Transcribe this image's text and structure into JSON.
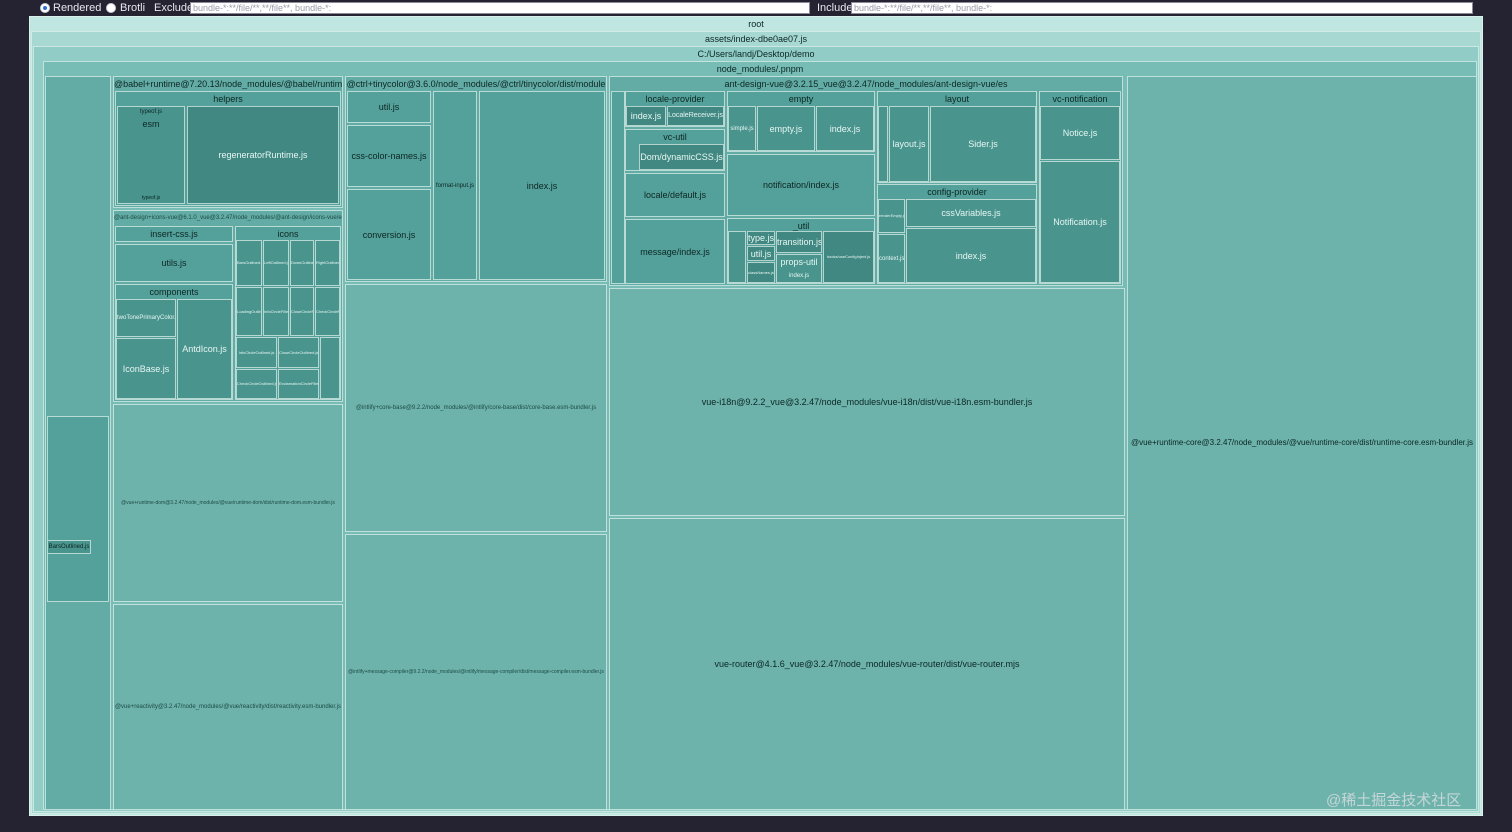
{
  "controls": {
    "rendered_label": "Rendered",
    "brotli_label": "Brotli",
    "exclude_label": "Exclude",
    "exclude_value": "bundle-*:**/file/**,**/file**, bundle-*:",
    "include_label": "Include",
    "include_value": "bundle-*:**/file/**,**/file**, bundle-*:"
  },
  "tree": {
    "root": "root",
    "asset": "assets/index-dbe0ae07.js",
    "path": "C:/Users/landj/Desktop/demo",
    "node_modules": "node_modules/.pnpm"
  },
  "babel": {
    "title": "@babel+runtime@7.20.13/node_modules/@babel/runtime",
    "helpers": "helpers",
    "typeof": "typeof.js",
    "esm": "esm",
    "regenerator": "regeneratorRuntime.js",
    "typeof2": "typeof.js"
  },
  "icons_vue": {
    "title": "@ant-design+icons-vue@6.1.0_vue@3.2.47/node_modules/@ant-design/icons-vue/es",
    "insert_css": "insert-css.js",
    "utils": "utils.js",
    "components": "components",
    "two_tone": "twoTonePrimaryColor.js",
    "icon_base": "IconBase.js",
    "antd_icon": "AntdIcon.js",
    "icons": "icons",
    "icon_files": [
      "BarsOutlined.js",
      "LeftOutlined.js",
      "DownOutlined.js",
      "RightOutlined.js",
      "LoadingOutlined.js",
      "InfoCircleFilled.js",
      "CloseCircleFilled.js",
      "CheckCircleFilled.js",
      "InfoCircleOutlined.js",
      "CloseCircleOutlined.js",
      "CheckCircleOutlined.js",
      "ExclamationCircleFilled.js"
    ]
  },
  "runtime_dom": "@vue+runtime-dom@3.2.47/node_modules/@vue/runtime-dom/dist/runtime-dom.esm-bundler.js",
  "reactivity": "@vue+reactivity@3.2.47/node_modules/@vue/reactivity/dist/reactivity.esm-bundler.js",
  "tinycolor": {
    "title": "@ctrl+tinycolor@3.6.0/node_modules/@ctrl/tinycolor/dist/module",
    "util": "util.js",
    "css_color_names": "css-color-names.js",
    "conversion": "conversion.js",
    "format_input": "format-input.js",
    "index": "index.js"
  },
  "intlify_core": "@intlify+core-base@9.2.2/node_modules/@intlify/core-base/dist/core-base.esm-bundler.js",
  "intlify_msg": "@intlify+message-compiler@9.2.2/node_modules/@intlify/message-compiler/dist/message-compiler.esm-bundler.js",
  "antd": {
    "title": "ant-design-vue@3.2.15_vue@3.2.47/node_modules/ant-design-vue/es",
    "locale_provider": "locale-provider",
    "lp_index": "index.js",
    "locale_receiver": "LocaleReceiver.js",
    "vc_util": "vc-util",
    "dynamic_css": "Dom/dynamicCSS.js",
    "locale_default": "locale/default.js",
    "message_index": "message/index.js",
    "empty": "empty",
    "simple": "simple.js",
    "empty_js": "empty.js",
    "empty_index": "index.js",
    "notification_index": "notification/index.js",
    "util": "_util",
    "type": "type.js",
    "transition": "transition.js",
    "util_js": "util.js",
    "props_util": "props-util",
    "props_index": "index.js",
    "class_names": "classNames.js",
    "use_config_inject": "hooks/useConfigInject.js",
    "layout": "layout",
    "layout_js": "layout.js",
    "sider": "Sider.js",
    "config_provider": "config-provider",
    "css_variables": "cssVariables.js",
    "render_empty": "renderEmpty.js",
    "context": "context.js",
    "cp_index": "index.js",
    "vc_notification": "vc-notification",
    "notice": "Notice.js",
    "notification": "Notification.js"
  },
  "vue_i18n": "vue-i18n@9.2.2_vue@3.2.47/node_modules/vue-i18n/dist/vue-i18n.esm-bundler.js",
  "vue_router": "vue-router@4.1.6_vue@3.2.47/node_modules/vue-router/dist/vue-router.mjs",
  "runtime_core": "@vue+runtime-core@3.2.47/node_modules/@vue/runtime-core/dist/runtime-core.esm-bundler.js",
  "left_column": {
    "bars_outlined": "BarsOutlined.js"
  },
  "watermark": "@稀土掘金技术社区"
}
